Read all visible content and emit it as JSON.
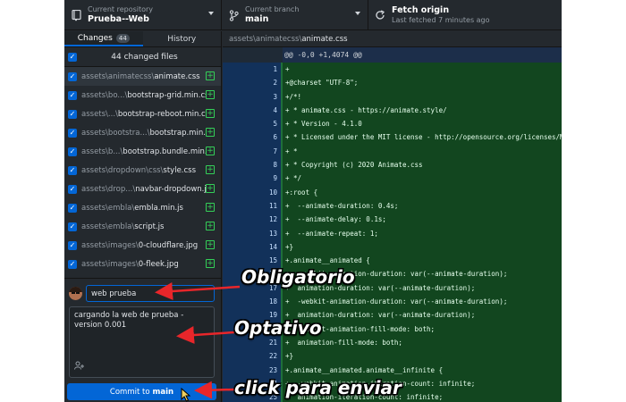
{
  "toolbar": {
    "repo": {
      "label": "Current repository",
      "value": "Prueba--Web",
      "icon": "repo-icon"
    },
    "branch": {
      "label": "Current branch",
      "value": "main",
      "icon": "branch-icon"
    },
    "fetch": {
      "label": "Fetch origin",
      "subtitle": "Last fetched 7 minutes ago",
      "icon": "sync-icon"
    }
  },
  "sidebar": {
    "tabs": [
      {
        "label": "Changes",
        "badge": "44"
      },
      {
        "label": "History"
      }
    ],
    "files_header": "44 changed files",
    "files": [
      {
        "dir": "assets\\animatecss\\",
        "name": "animate.css"
      },
      {
        "dir": "assets\\bo...\\",
        "name": "bootstrap-grid.min.css"
      },
      {
        "dir": "assets\\...\\",
        "name": "bootstrap-reboot.min.css"
      },
      {
        "dir": "assets\\bootstra...\\",
        "name": "bootstrap.min.css"
      },
      {
        "dir": "assets\\b...\\",
        "name": "bootstrap.bundle.min.js"
      },
      {
        "dir": "assets\\dropdown\\css\\",
        "name": "style.css"
      },
      {
        "dir": "assets\\drop...\\",
        "name": "navbar-dropdown.js"
      },
      {
        "dir": "assets\\embla\\",
        "name": "embla.min.js"
      },
      {
        "dir": "assets\\embla\\",
        "name": "script.js"
      },
      {
        "dir": "assets\\images\\",
        "name": "0-cloudflare.jpg"
      },
      {
        "dir": "assets\\images\\",
        "name": "0-fleek.jpg"
      }
    ]
  },
  "commit": {
    "summary": "web prueba",
    "description": "cargando la web de prueba - version 0.001",
    "button_prefix": "Commit to",
    "button_branch": "main"
  },
  "diff": {
    "path_prefix": "assets\\animatecss\\",
    "path_file": "animate.css",
    "hunk": "@@ -0,0 +1,4074 @@",
    "lines": [
      {
        "n": "1",
        "text": "+"
      },
      {
        "n": "2",
        "text": "+@charset \"UTF-8\";"
      },
      {
        "n": "3",
        "text": "+/*!"
      },
      {
        "n": "4",
        "text": "+ * animate.css - https://animate.style/"
      },
      {
        "n": "5",
        "text": "+ * Version - 4.1.0"
      },
      {
        "n": "6",
        "text": "+ * Licensed under the MIT license - http://opensource.org/licenses/MIT"
      },
      {
        "n": "7",
        "text": "+ *"
      },
      {
        "n": "8",
        "text": "+ * Copyright (c) 2020 Animate.css"
      },
      {
        "n": "9",
        "text": "+ */"
      },
      {
        "n": "10",
        "text": "+:root {"
      },
      {
        "n": "11",
        "text": "+  --animate-duration: 0.4s;"
      },
      {
        "n": "12",
        "text": "+  --animate-delay: 0.1s;"
      },
      {
        "n": "13",
        "text": "+  --animate-repeat: 1;"
      },
      {
        "n": "14",
        "text": "+}"
      },
      {
        "n": "15",
        "text": "+.animate__animated {"
      },
      {
        "n": "16",
        "text": "+  -webkit-animation-duration: var(--animate-duration);"
      },
      {
        "n": "17",
        "text": "+  animation-duration: var(--animate-duration);"
      },
      {
        "n": "18",
        "text": "+  -webkit-animation-duration: var(--animate-duration);"
      },
      {
        "n": "19",
        "text": "+  animation-duration: var(--animate-duration);"
      },
      {
        "n": "20",
        "text": "+  -webkit-animation-fill-mode: both;"
      },
      {
        "n": "21",
        "text": "+  animation-fill-mode: both;"
      },
      {
        "n": "22",
        "text": "+}"
      },
      {
        "n": "23",
        "text": "+.animate__animated.animate__infinite {"
      },
      {
        "n": "24",
        "text": "+  -webkit-animation-iteration-count: infinite;"
      },
      {
        "n": "25",
        "text": "+  animation-iteration-count: infinite;"
      }
    ]
  },
  "annotations": {
    "required": "Obligatorio",
    "optional": "Optativo",
    "send": "click para enviar",
    "arrow_color": "#e8262a"
  },
  "colors": {
    "accent": "#0366d6",
    "added_bg": "#12461f",
    "gutter_bg": "#12315a",
    "added_icon": "#34d058"
  }
}
